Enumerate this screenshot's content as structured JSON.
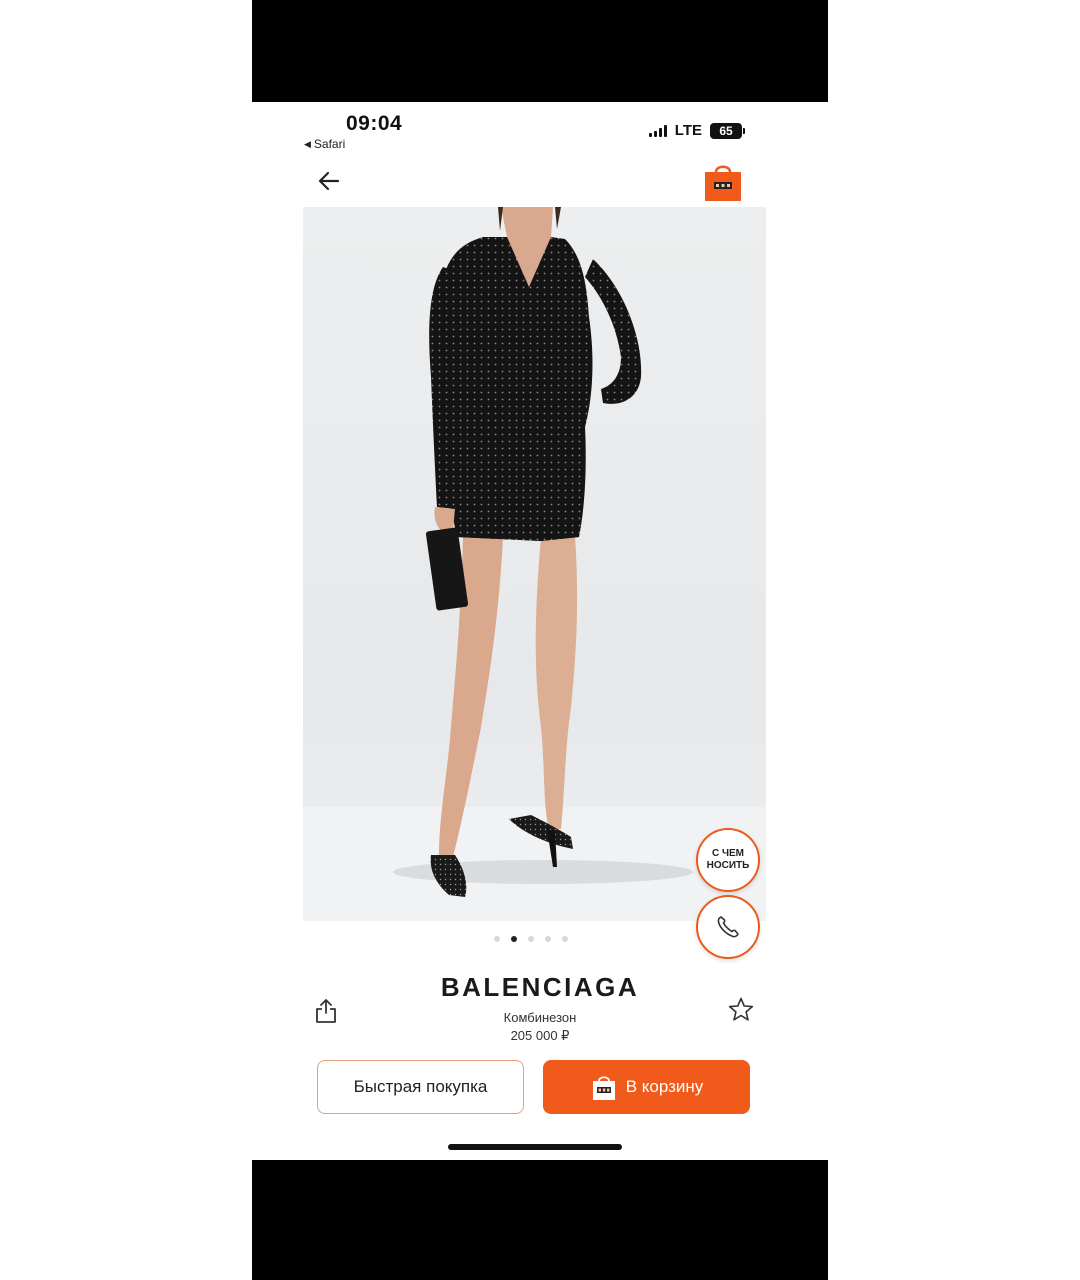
{
  "status_bar": {
    "time": "09:04",
    "back_app": "Safari",
    "network": "LTE",
    "battery": "65"
  },
  "header": {
    "back_icon": "arrow-left-icon",
    "cart_icon": "shopping-bag-icon",
    "accent_color": "#f05a1a"
  },
  "gallery": {
    "image_count": 5,
    "active_index": 1
  },
  "floating": {
    "wear_with_label": "С ЧЕМ\nНОСИТЬ",
    "call_icon": "phone-icon"
  },
  "product": {
    "brand": "BALENCIAGA",
    "category": "Комбинезон",
    "price": "205 000 ₽"
  },
  "actions": {
    "quick_buy_label": "Быстрая покупка",
    "add_to_cart_label": "В корзину",
    "share_icon": "share-icon",
    "favorite_icon": "star-icon"
  }
}
